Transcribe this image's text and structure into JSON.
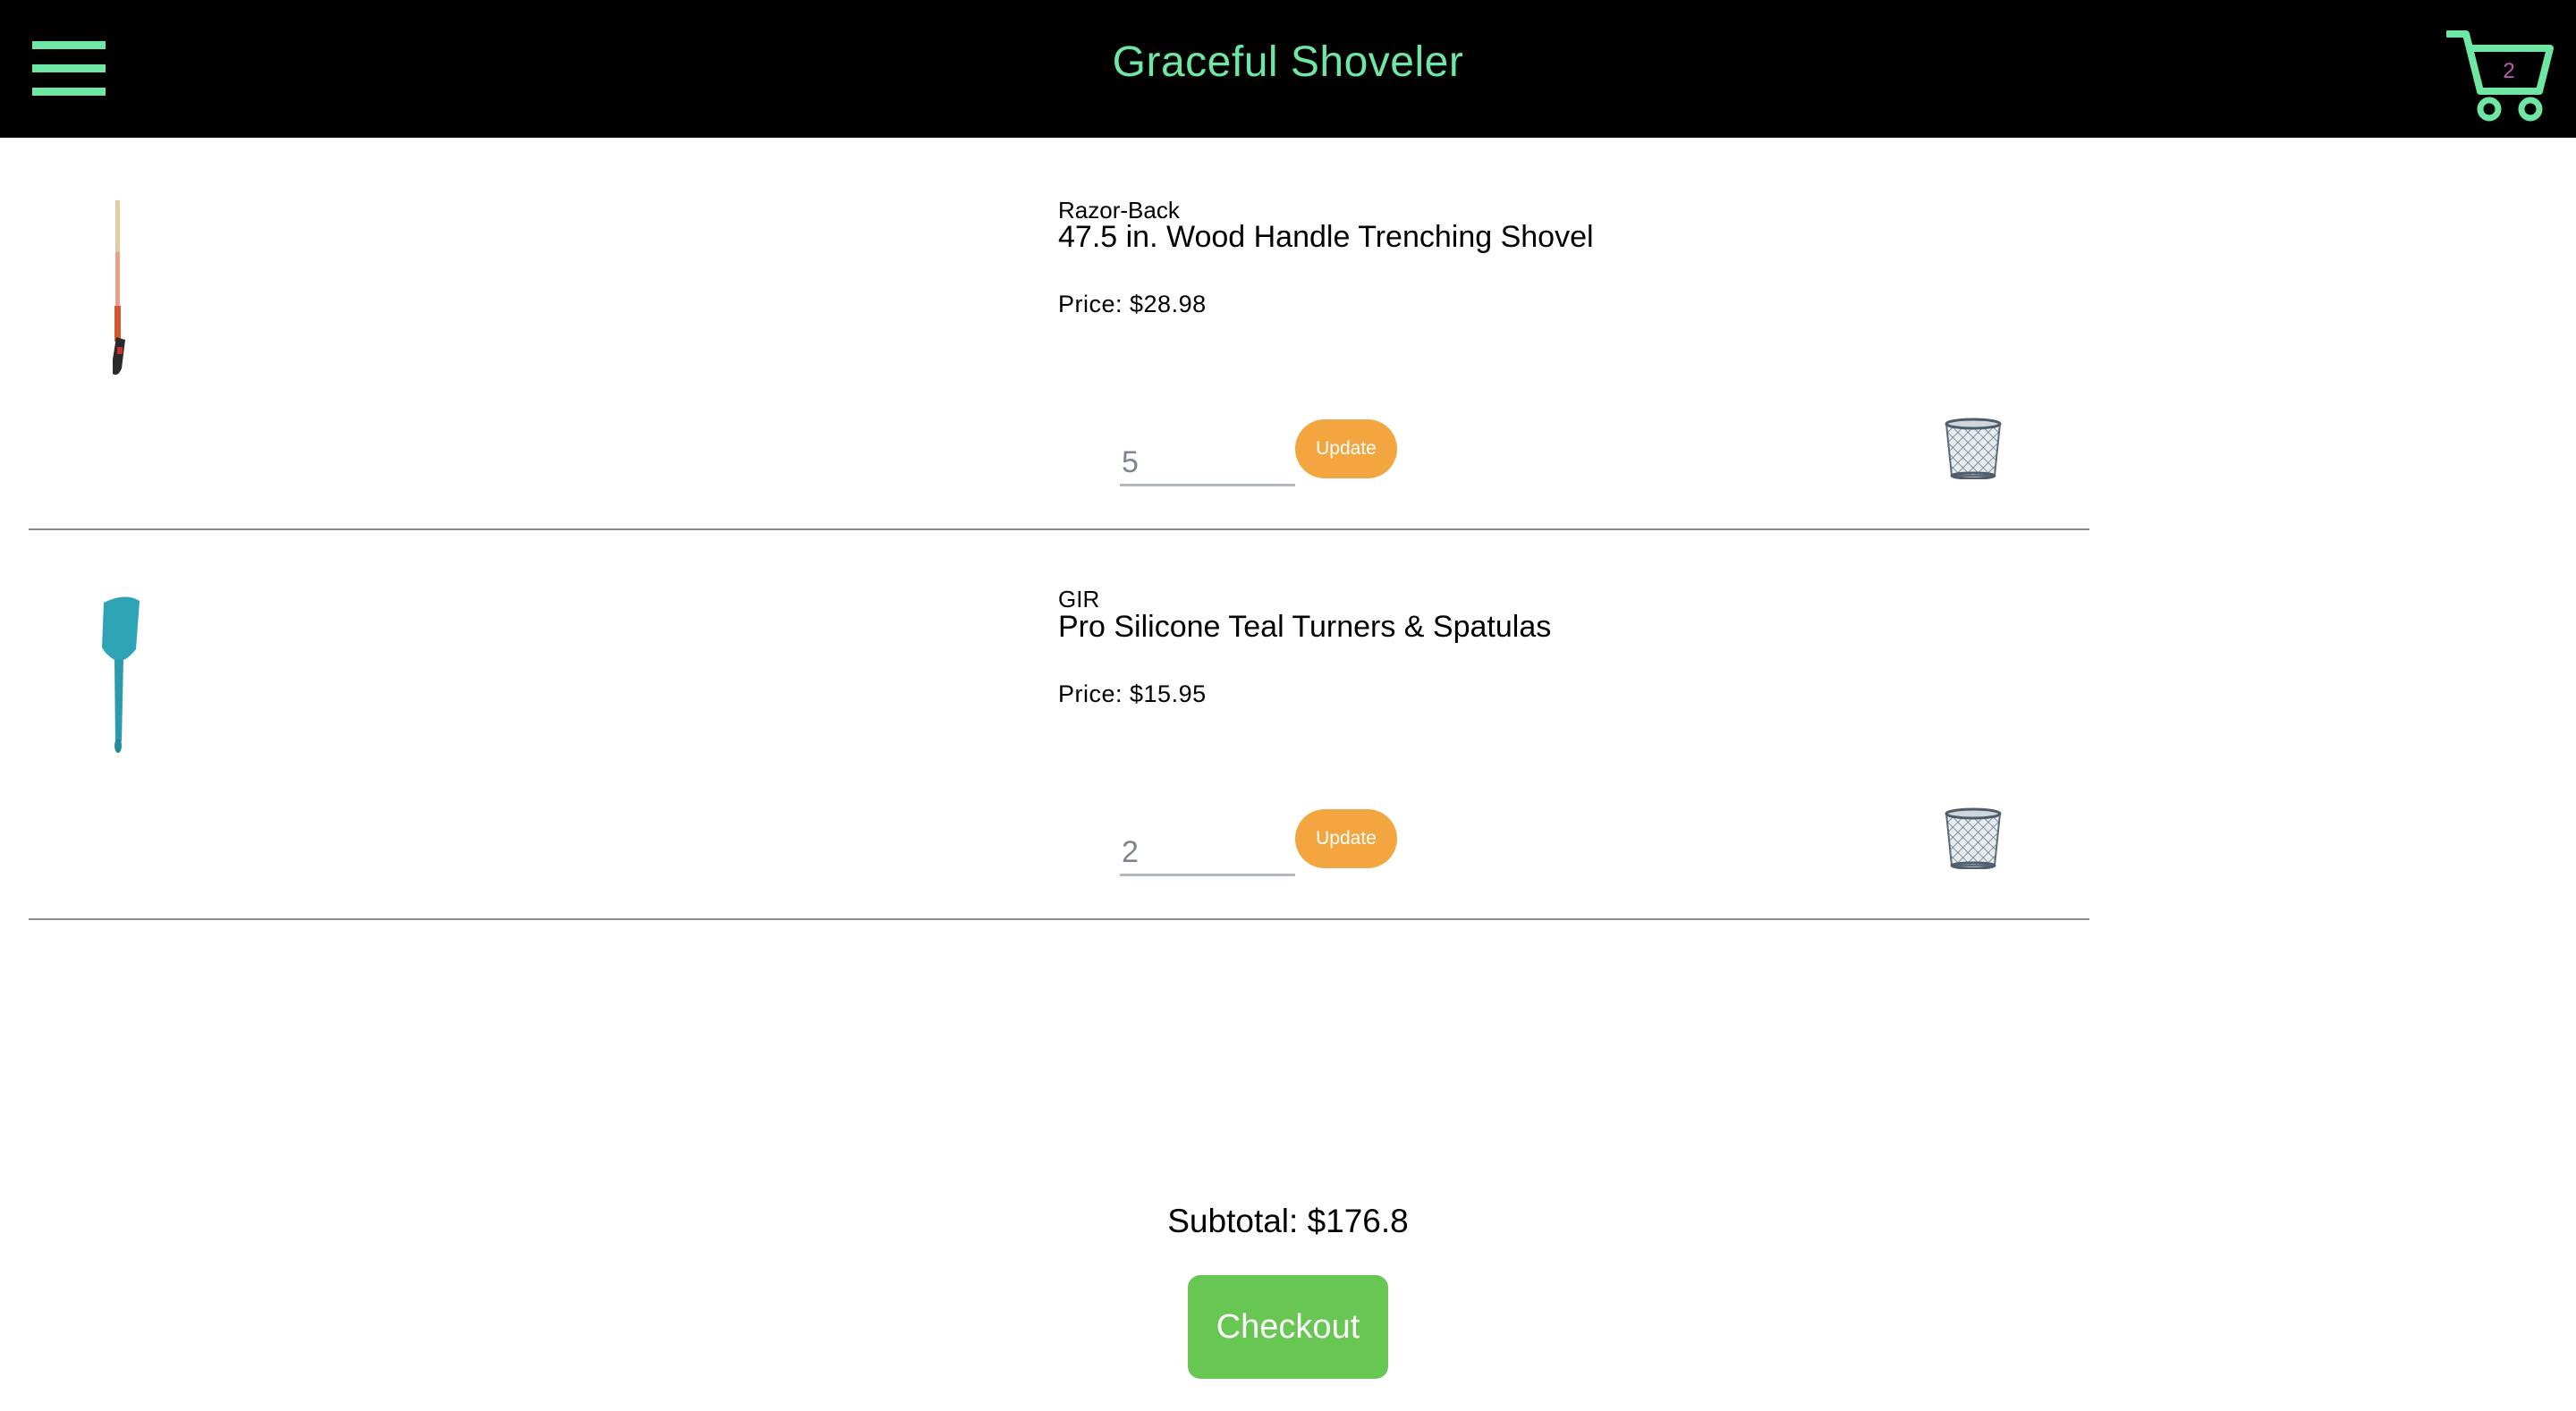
{
  "header": {
    "brand": "Graceful Shoveler",
    "menu_icon": "hamburger-menu-icon",
    "cart_icon": "shopping-cart-icon",
    "cart_count": "2"
  },
  "colors": {
    "header_bg": "#000000",
    "accent": "#6ee7a4",
    "update_button": "#f3a63f",
    "checkout_button": "#68c653",
    "cart_count": "#c45ab3"
  },
  "cart": {
    "items": [
      {
        "brand": "Razor-Back",
        "title": "47.5 in. Wood Handle Trenching Shovel",
        "price": "Price: $28.98",
        "quantity": "5",
        "update_label": "Update",
        "image_icon": "shovel-image",
        "delete_icon": "trash-can-icon"
      },
      {
        "brand": "GIR",
        "title": "Pro Silicone Teal Turners & Spatulas",
        "price": "Price: $15.95",
        "quantity": "2",
        "update_label": "Update",
        "image_icon": "spatula-image",
        "delete_icon": "trash-can-icon"
      }
    ],
    "subtotal": "Subtotal: $176.8",
    "checkout_label": "Checkout"
  }
}
